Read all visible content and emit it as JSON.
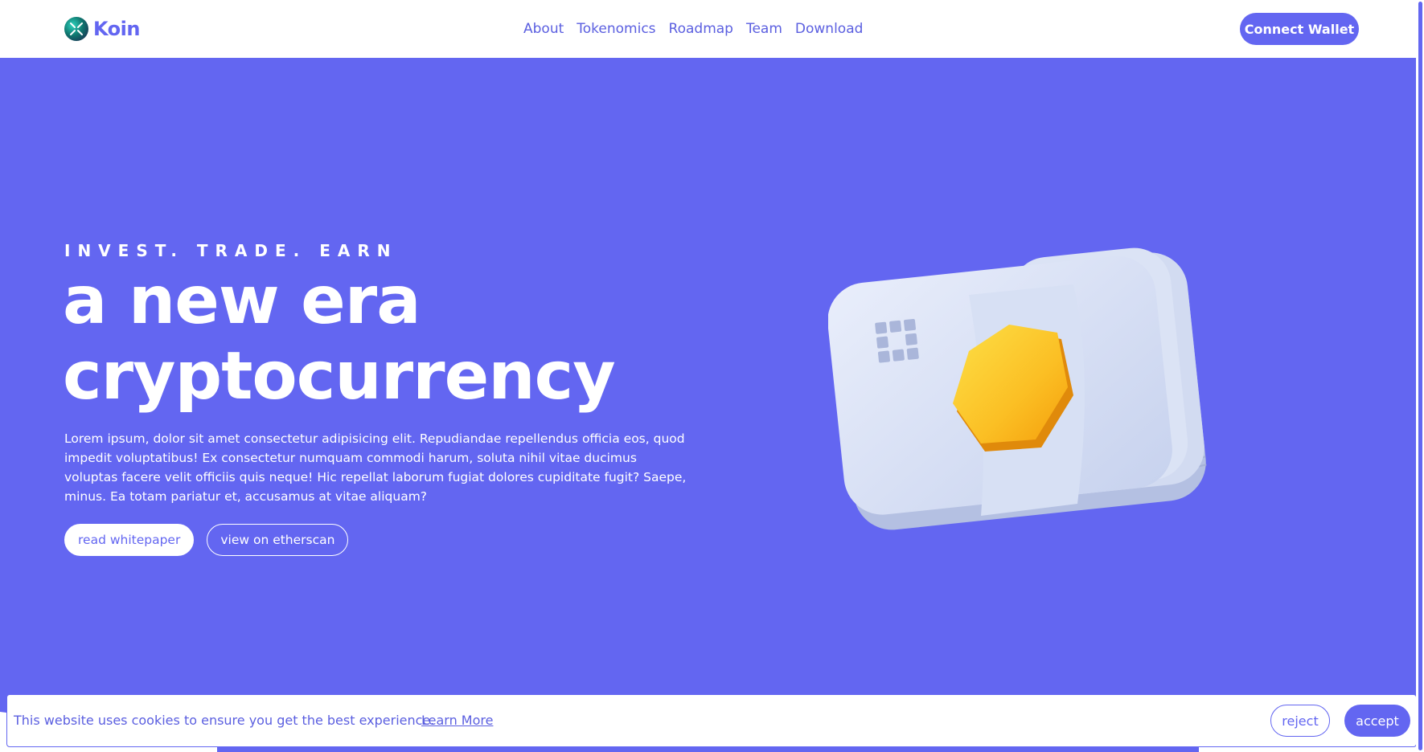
{
  "brand": {
    "name": "Koin",
    "logo_icon": "koin-logo-icon"
  },
  "nav": {
    "items": [
      {
        "label": "About"
      },
      {
        "label": "Tokenomics"
      },
      {
        "label": "Roadmap"
      },
      {
        "label": "Team"
      },
      {
        "label": "Download"
      }
    ]
  },
  "header": {
    "connect_label": "Connect Wallet"
  },
  "hero": {
    "eyebrow": "INVEST. TRADE. EARN",
    "headline": "a new era cryptocurrency",
    "body": "Lorem ipsum, dolor sit amet consectetur adipisicing elit. Repudiandae repellendus officia eos, quod impedit voluptatibus! Ex consectetur numquam commodi harum, soluta nihil vitae ducimus voluptas facere velit officiis quis neque! Hic repellat laborum fugiat dolores cupiditate fugit? Saepe, minus. Ea totam pariatur et, accusamus at vitae aliquam?",
    "primary_label": "read whitepaper",
    "secondary_label": "view on etherscan",
    "illustration": "crypto-card-stack-illustration"
  },
  "cookie": {
    "message": "This website uses cookies to ensure you get the best experience.",
    "link_label": "Learn More",
    "reject_label": "reject",
    "accept_label": "accept"
  },
  "colors": {
    "accent": "#6366f1",
    "background": "#ffffff",
    "coin": "#fbbf24",
    "card": "#dbe4f6"
  }
}
